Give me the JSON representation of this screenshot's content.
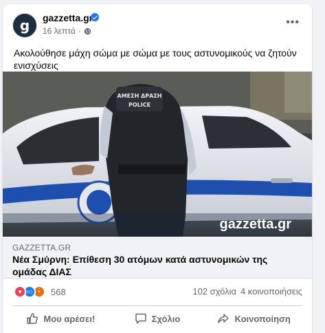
{
  "post": {
    "page_name": "gazzetta.gr",
    "verified": true,
    "time": "16 λεπτά",
    "separator": "·",
    "privacy_icon": "globe-icon",
    "avatar_letter": "g",
    "text": "Ακολούθησε μάχη σώμα με σώμα με τους αστυνομικούς να ζητούν ενισχύσεις"
  },
  "image": {
    "helmet_text_1": "ΑΜΕΣΗ ΔΡΑΣΗ",
    "helmet_text_2": "POLICE",
    "watermark": "gazzetta.gr",
    "colors": {
      "accent": "#1877f2",
      "car": "#e6e9ee",
      "stripe": "#1f4fae",
      "vest": "#22252a"
    }
  },
  "link": {
    "domain": "GAZZETTA.GR",
    "title": "Νέα Σμύρνη: Επίθεση 30 ατόμων κατά αστυνομικών της ομάδας ΔΙΑΣ"
  },
  "stats": {
    "reaction_icons": [
      "love-icon",
      "like-icon",
      "angry-icon"
    ],
    "reaction_count": "568",
    "comments": "102 σχόλια",
    "shares": "4 κοινοποιήσεις"
  },
  "actions": {
    "like": "Μου αρέσει!",
    "comment": "Σχόλιο",
    "share": "Κοινοποίηση"
  }
}
